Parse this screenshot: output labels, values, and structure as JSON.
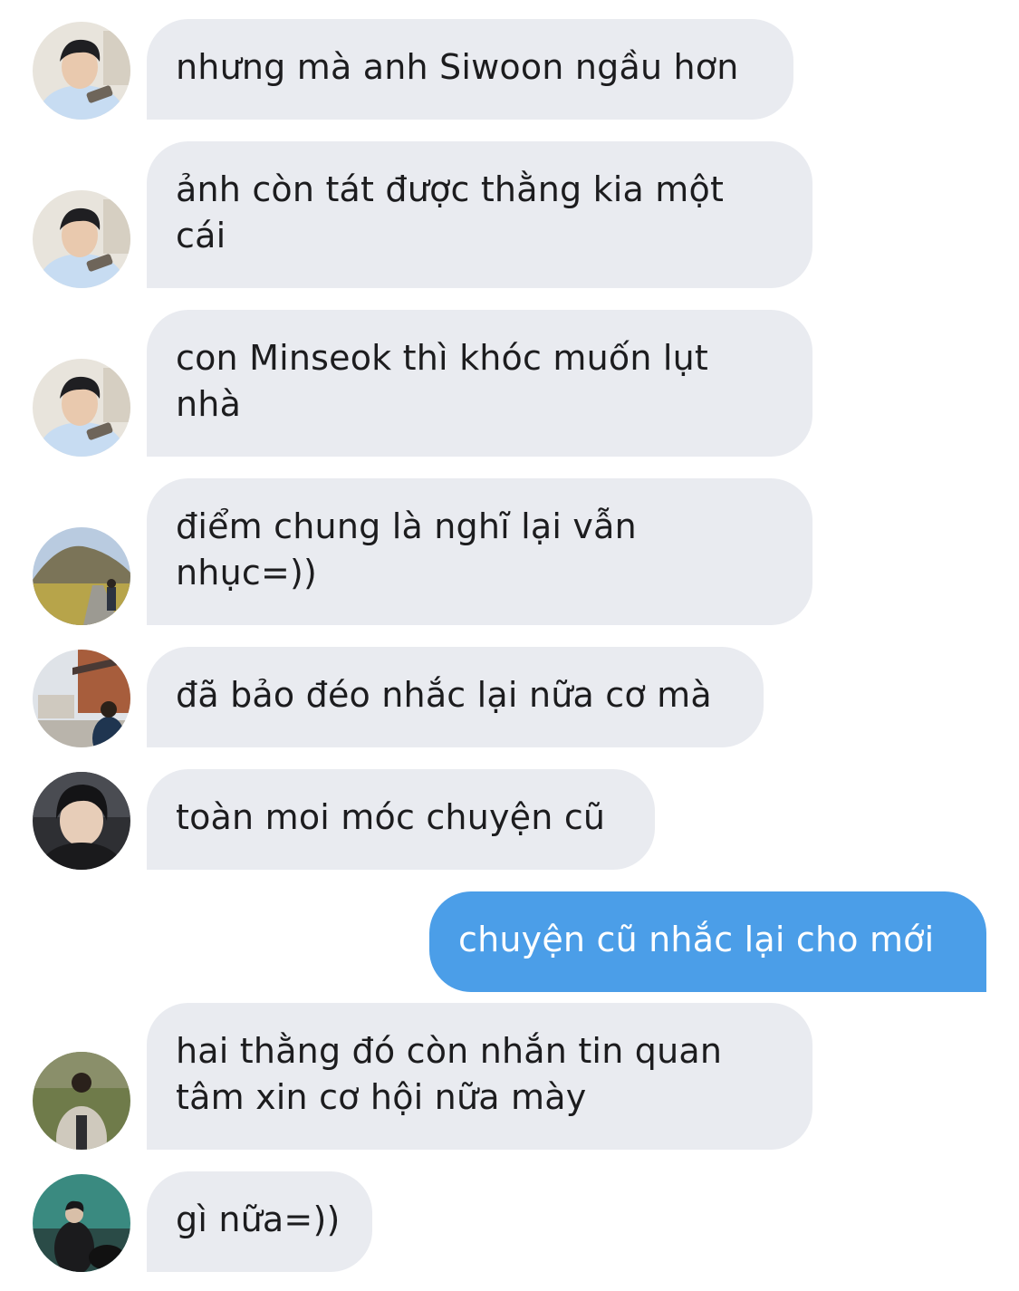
{
  "messages": [
    {
      "sender": "avatar-a",
      "direction": "incoming",
      "text": "nhưng mà anh Siwoon ngầu hơn"
    },
    {
      "sender": "avatar-a",
      "direction": "incoming",
      "text": "ảnh còn tát được thằng kia một cái"
    },
    {
      "sender": "avatar-a",
      "direction": "incoming",
      "text": "con Minseok thì khóc muốn lụt nhà"
    },
    {
      "sender": "avatar-b",
      "direction": "incoming",
      "text": "điểm chung là nghĩ lại vẫn nhục=))"
    },
    {
      "sender": "avatar-c",
      "direction": "incoming",
      "text": "đã bảo đéo nhắc lại nữa cơ mà"
    },
    {
      "sender": "avatar-d",
      "direction": "incoming",
      "text": "toàn moi móc chuyện cũ"
    },
    {
      "sender": "me",
      "direction": "outgoing",
      "text": "chuyện cũ nhắc lại cho mới"
    },
    {
      "sender": "avatar-e",
      "direction": "incoming",
      "text": "hai thằng đó còn nhắn tin quan tâm xin cơ hội nữa mày"
    },
    {
      "sender": "avatar-f",
      "direction": "incoming",
      "text": "gì nữa=))"
    }
  ],
  "colors": {
    "incoming_bubble": "#e9ebf0",
    "outgoing_bubble": "#4b9ee8",
    "incoming_text": "#1c1c1e",
    "outgoing_text": "#ffffff"
  }
}
